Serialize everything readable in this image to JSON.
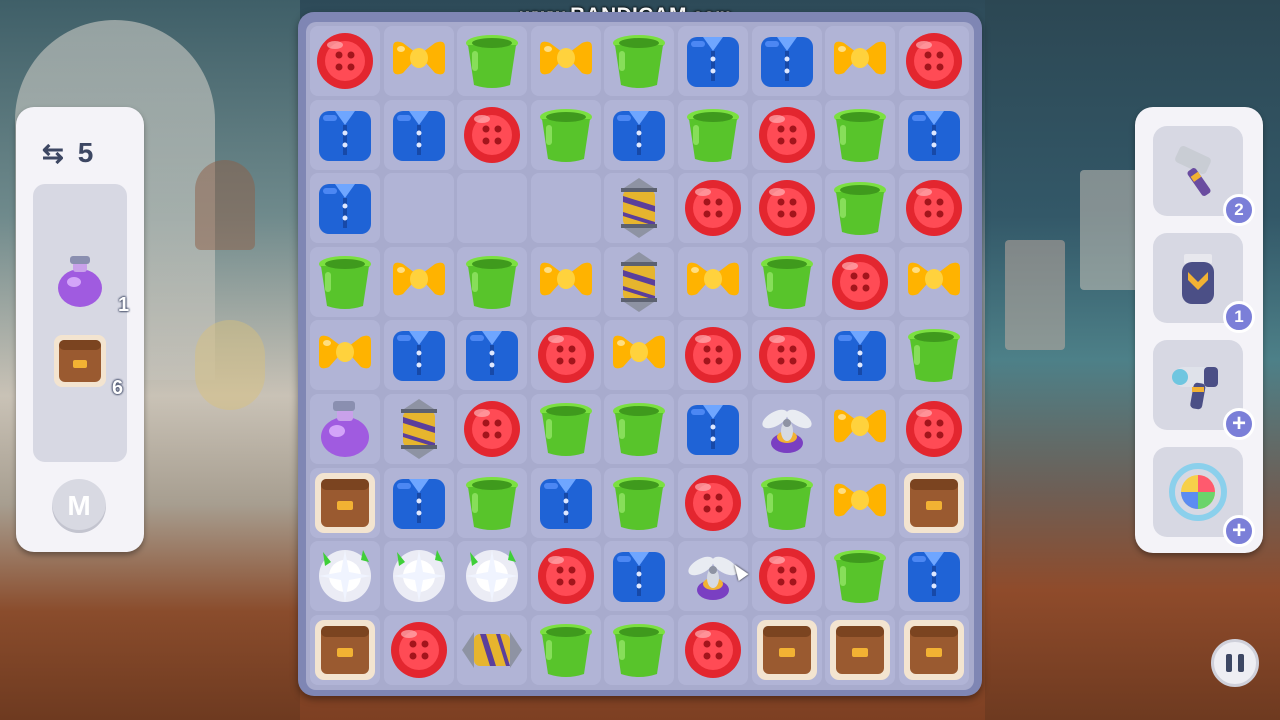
{
  "watermark": {
    "prefix": "www.",
    "brand": "BANDICAM",
    "suffix": ".com"
  },
  "moves": {
    "icon": "swap-arrows-icon",
    "value": "5"
  },
  "goals": [
    {
      "item": "purple-potion-bottle",
      "remaining": "1"
    },
    {
      "item": "wooden-drawer-box",
      "remaining": "6"
    }
  ],
  "menu_button": {
    "label": "M"
  },
  "boosters": [
    {
      "name": "hammer",
      "icon": "hammer-icon",
      "badge": "2"
    },
    {
      "name": "hair-clipper",
      "icon": "clipper-icon",
      "badge": "1"
    },
    {
      "name": "hair-dryer",
      "icon": "hair-dryer-icon",
      "badge": "+"
    },
    {
      "name": "shuffle",
      "icon": "shuffle-icon",
      "badge": "+"
    }
  ],
  "colors": {
    "board": "#7f86b4",
    "button_red": "#e3262f",
    "shirt_blue": "#1f63d6",
    "bow_yellow": "#ffb300",
    "pot_green": "#58c42b",
    "badge_purple": "#7b7fd8"
  },
  "board": {
    "columns": 9,
    "rows": 9,
    "grid": [
      [
        "button",
        "bow",
        "pot",
        "bow",
        "pot",
        "shirt",
        "shirt",
        "bow",
        "button"
      ],
      [
        "shirt",
        "shirt",
        "button",
        "pot",
        "shirt",
        "pot",
        "button",
        "pot",
        "shirt"
      ],
      [
        "shirt",
        "empty",
        "empty",
        "empty",
        "rocket",
        "button",
        "button",
        "pot",
        "button"
      ],
      [
        "pot",
        "bow",
        "pot",
        "bow",
        "rocket",
        "bow",
        "pot",
        "button",
        "bow"
      ],
      [
        "bow",
        "shirt",
        "shirt",
        "button",
        "bow",
        "button",
        "button",
        "shirt",
        "pot"
      ],
      [
        "potion",
        "rocket",
        "button",
        "pot",
        "pot",
        "shirt",
        "propeller",
        "bow",
        "button"
      ],
      [
        "drawer",
        "shirt",
        "pot",
        "shirt",
        "pot",
        "button",
        "pot",
        "bow",
        "drawer"
      ],
      [
        "sparkle",
        "sparkle",
        "sparkle",
        "button",
        "shirt",
        "propeller",
        "button",
        "pot",
        "shirt"
      ],
      [
        "drawer",
        "button",
        "rocket-h",
        "pot",
        "pot",
        "button",
        "drawer",
        "drawer",
        "drawer"
      ]
    ]
  }
}
